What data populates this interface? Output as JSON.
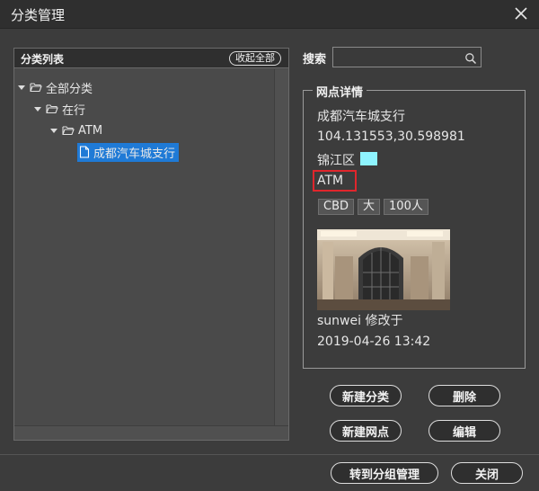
{
  "dialog": {
    "title": "分类管理"
  },
  "tree": {
    "header": "分类列表",
    "collapse_all": "收起全部",
    "nodes": [
      {
        "label": "全部分类"
      },
      {
        "label": "在行"
      },
      {
        "label": "ATM"
      },
      {
        "label": "成都汽车城支行",
        "selected": true
      }
    ]
  },
  "search": {
    "label": "搜索",
    "value": "",
    "placeholder": ""
  },
  "details": {
    "legend": "网点详情",
    "name": "成都汽车城支行",
    "coords": "104.131553,30.598981",
    "district": "锦江区",
    "district_color": "#8ef4ff",
    "category": "ATM",
    "tags": [
      "CBD",
      "大",
      "100人"
    ],
    "modifier": "sunwei 修改于",
    "modified_time": "2019-04-26 13:42"
  },
  "actions": {
    "new_category": "新建分类",
    "delete": "删除",
    "new_branch": "新建网点",
    "edit": "编辑",
    "go_group": "转到分组管理",
    "close": "关闭"
  },
  "colors": {
    "selection": "#1f7ad6",
    "highlight_border": "#e0262c"
  }
}
